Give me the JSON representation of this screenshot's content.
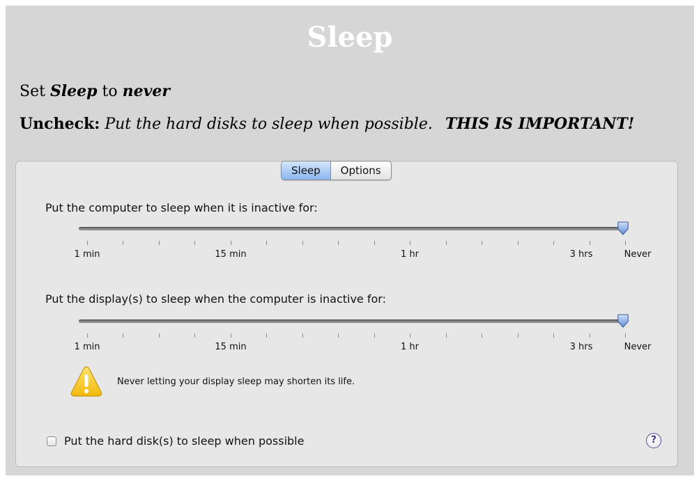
{
  "heading": {
    "title": "Sleep",
    "line1_prefix": "Set ",
    "line1_bold": "Sleep",
    "line1_mid": " to ",
    "line1_bold2": "never",
    "line2_prefix": "Uncheck:",
    "line2_italic": " Put the hard disks to sleep when possible.",
    "line2_important": "THIS IS IMPORTANT!"
  },
  "tabs": [
    {
      "label": "Sleep",
      "active": true
    },
    {
      "label": "Options",
      "active": false
    }
  ],
  "computer_slider": {
    "label": "Put the computer to sleep when it is inactive for:",
    "value": "Never",
    "tick_labels": [
      "1 min",
      "15 min",
      "1 hr",
      "3 hrs",
      "Never"
    ]
  },
  "display_slider": {
    "label": "Put the display(s) to sleep when the computer is inactive for:",
    "value": "Never",
    "tick_labels": [
      "1 min",
      "15 min",
      "1 hr",
      "3 hrs",
      "Never"
    ]
  },
  "warning": {
    "icon": "warning-icon",
    "text": "Never letting your display sleep may shorten its life."
  },
  "hard_disk_checkbox": {
    "label": "Put the hard disk(s) to sleep when possible",
    "checked": false
  },
  "help": {
    "icon": "help-icon",
    "glyph": "?"
  },
  "colors": {
    "card_bg": "#d6d6d6",
    "panel_bg": "#e7e7e7",
    "thumb": "#5f8fd8",
    "warning_yellow": "#f7c81a"
  }
}
